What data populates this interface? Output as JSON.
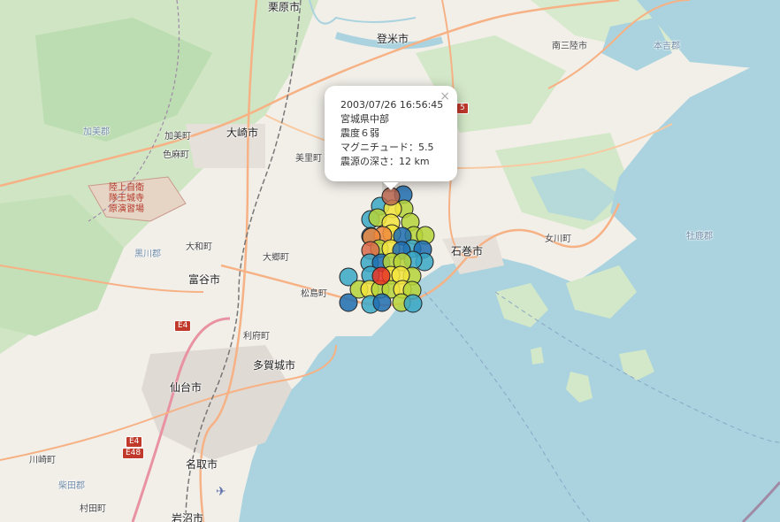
{
  "map": {
    "labels": {
      "kurihara": "栗原市",
      "tome": "登米市",
      "minamisanriku": "南三陸市",
      "motoyoshi": "本吉郡",
      "kami": "加美郡",
      "kami_town": "加美町",
      "osaki": "大崎市",
      "shikama": "色麻町",
      "misato": "美里町",
      "ishinomaki": "石巻市",
      "onagawa": "女川町",
      "oshika": "牡鹿郡",
      "owa": "大和町",
      "kurokawa": "黒川郡",
      "osato": "大郷町",
      "tomiya": "富谷市",
      "matsushima": "松島町",
      "rifu": "利府町",
      "tagajo": "多賀城市",
      "sendai": "仙台市",
      "natori": "名取市",
      "kawasaki": "川崎町",
      "shibata": "柴田郡",
      "murata": "村田町",
      "iwanuma": "岩沼市",
      "ojiji_1": "陸上自衛",
      "ojiji_2": "隊王城寺",
      "ojiji_3": "原演習場"
    },
    "shields": {
      "e4_north": "E4",
      "e4_south": "E4",
      "e48": "E48",
      "partial": "5"
    },
    "marker_colors": {
      "red": "#e63022",
      "orange": "#f08a3c",
      "salmon": "#d9694a",
      "yellow": "#f2e43d",
      "lime": "#b6d33a",
      "teal": "#3aa7c6",
      "blue": "#1e6db0",
      "brown": "#b8654e"
    },
    "popup": {
      "datetime": "2003/07/26 16:56:45",
      "region": "宮城県中部",
      "intensity": "震度６弱",
      "magnitude": "マグニチュード：5.5",
      "depth": "震源の深さ：12 km",
      "close_symbol": "×"
    }
  }
}
